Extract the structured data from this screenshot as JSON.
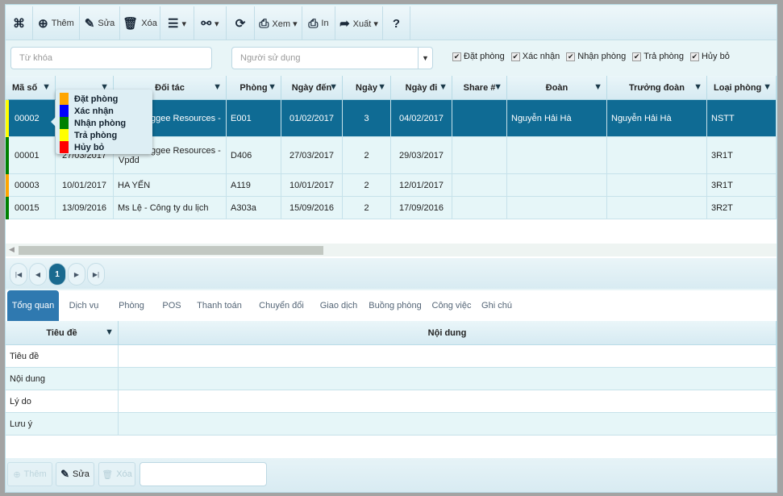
{
  "toolbar": {
    "items": [
      {
        "icon": "binoculars-icon",
        "label": ""
      },
      {
        "icon": "plus-circle-icon",
        "label": "Thêm"
      },
      {
        "icon": "pencil-icon",
        "label": "Sửa"
      },
      {
        "icon": "trash-icon",
        "label": "Xóa"
      },
      {
        "icon": "menu-icon",
        "label": "▾"
      },
      {
        "icon": "link-icon",
        "label": "▾"
      },
      {
        "icon": "refresh-icon",
        "label": ""
      },
      {
        "icon": "print-icon",
        "label": "Xem ▾"
      },
      {
        "icon": "print-icon",
        "label": "In"
      },
      {
        "icon": "share-icon",
        "label": "Xuất ▾"
      },
      {
        "icon": "help-icon",
        "label": ""
      }
    ]
  },
  "filters": {
    "keyword_placeholder": "Từ khóa",
    "user_placeholder": "Người sử dụng",
    "statuses": [
      {
        "label": "Đặt phòng",
        "checked": true
      },
      {
        "label": "Xác nhận",
        "checked": true
      },
      {
        "label": "Nhận phòng",
        "checked": true
      },
      {
        "label": "Trả phòng",
        "checked": true
      },
      {
        "label": "Hủy bỏ",
        "checked": true
      }
    ]
  },
  "grid": {
    "columns": [
      "Mã số",
      "",
      "Đối tác",
      "Phòng",
      "Ngày đến",
      "Ngày",
      "Ngày đi",
      "Share #",
      "Đoàn",
      "Trưởng đoàn",
      "Loại phòng"
    ],
    "rows": [
      {
        "status_color": "#ffff00",
        "selected": true,
        "cells": [
          "00002",
          "",
          "ggee Resources -",
          "E001",
          "01/02/2017",
          "3",
          "04/02/2017",
          "",
          "Nguyễn Hải Hà",
          "Nguyễn Hải Hà",
          "NSTT"
        ]
      },
      {
        "status_color": "#008000",
        "cells": [
          "00001",
          "27/03/2017",
          "ggee Resources -\nVpđd",
          "D406",
          "27/03/2017",
          "2",
          "29/03/2017",
          "",
          "",
          "",
          "3R1T"
        ]
      },
      {
        "status_color": "#ffa500",
        "cells": [
          "00003",
          "10/01/2017",
          "HA YẾN",
          "A119",
          "10/01/2017",
          "2",
          "12/01/2017",
          "",
          "",
          "",
          "3R1T"
        ]
      },
      {
        "status_color": "#008000",
        "cells": [
          "00015",
          "13/09/2016",
          "Ms Lệ - Công ty du lịch",
          "A303a",
          "15/09/2016",
          "2",
          "17/09/2016",
          "",
          "",
          "",
          "3R2T"
        ]
      }
    ]
  },
  "legend": [
    {
      "label": "Đặt phòng",
      "color": "#ffa500"
    },
    {
      "label": "Xác nhận",
      "color": "#0000ff"
    },
    {
      "label": "Nhận phòng",
      "color": "#008000"
    },
    {
      "label": "Trả phòng",
      "color": "#ffff00"
    },
    {
      "label": "Hủy bỏ",
      "color": "#ff0000"
    }
  ],
  "pager": {
    "current": "1"
  },
  "tabs": [
    "Tổng quan",
    "Dịch vụ",
    "Phòng",
    "POS",
    "Thanh toán",
    "Chuyển đổi",
    "Giao dịch",
    "Buồng phòng",
    "Công việc",
    "Ghi chú"
  ],
  "detail": {
    "columns": [
      "Tiêu đề",
      "Nội dung"
    ],
    "rows": [
      "Tiêu đề",
      "Nội dung",
      "Lý do",
      "Lưu ý"
    ]
  },
  "bottom": {
    "add": "Thêm",
    "edit": "Sửa",
    "delete": "Xóa"
  }
}
